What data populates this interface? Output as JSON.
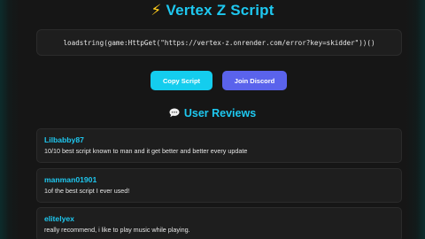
{
  "header": {
    "title": "Vertex Z Script",
    "title_icon": "lightning-bolt-icon",
    "accent_color": "#1ec8f0"
  },
  "script": {
    "code": "loadstring(game:HttpGet(\"https://vertex-z.onrender.com/error?key=skidder\"))()"
  },
  "actions": {
    "copy_label": "Copy Script",
    "copy_color": "#14cdee",
    "discord_label": "Join Discord",
    "discord_color": "#5a63ec"
  },
  "reviews": {
    "heading": "User Reviews",
    "heading_icon": "speech-bubble-icon",
    "items": [
      {
        "name": "Lilbabby87",
        "text": "10/10 best script known to man and it get better and better every update"
      },
      {
        "name": "manman01901",
        "text": "1of the best script I ever used!"
      },
      {
        "name": "elitelyex",
        "text": "really recommend, i like to play music while playing."
      }
    ]
  }
}
